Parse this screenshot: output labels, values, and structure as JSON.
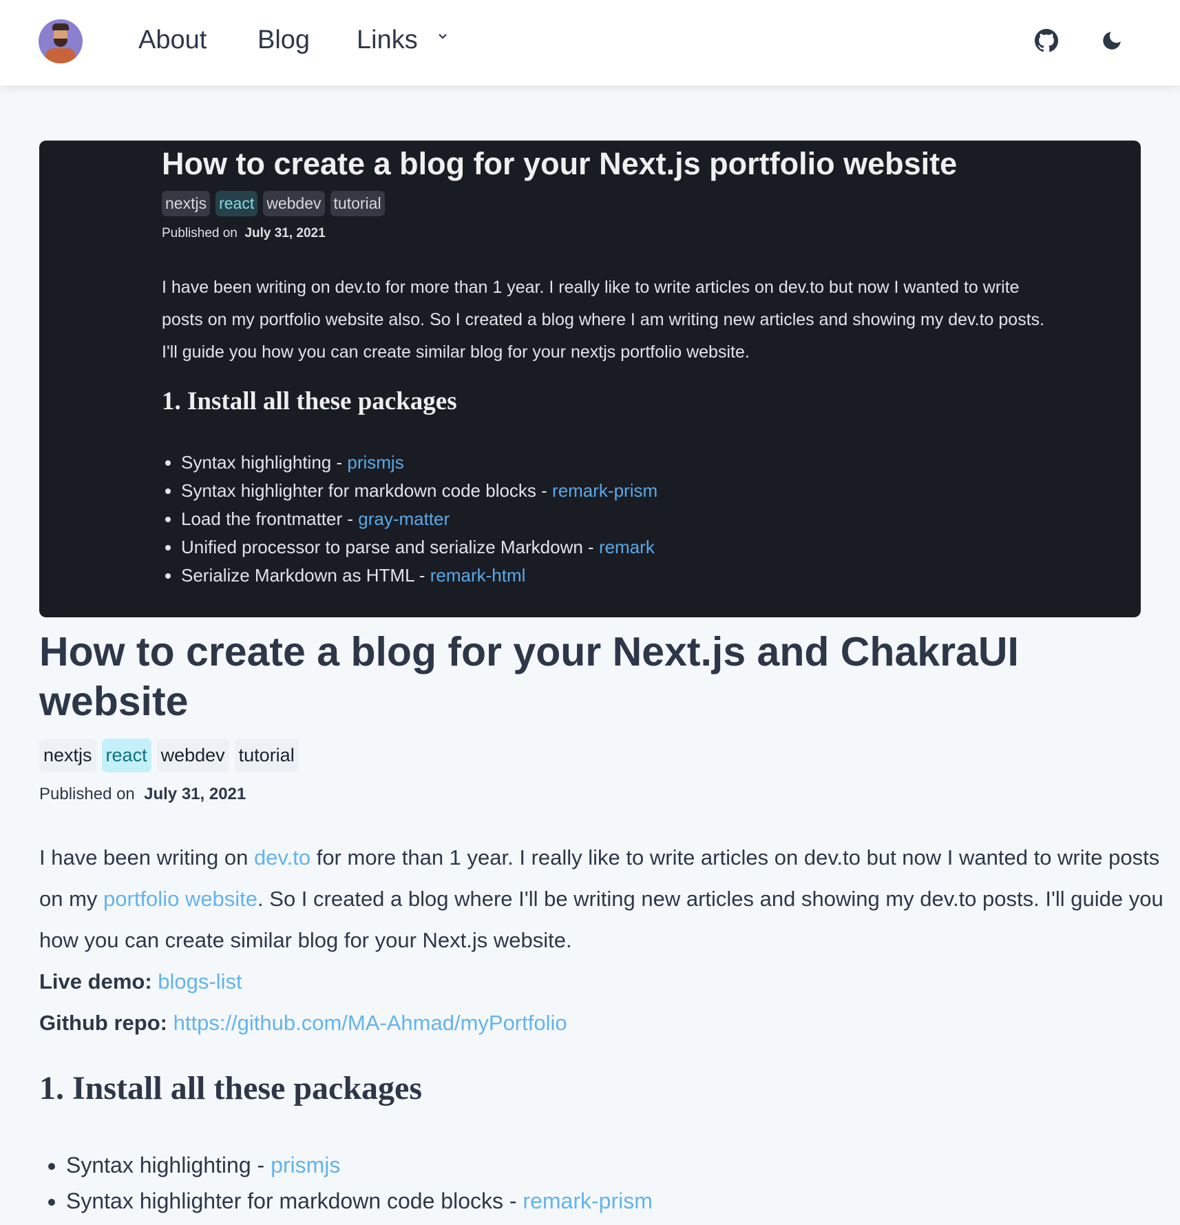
{
  "nav": {
    "links": [
      "About",
      "Blog",
      "Links"
    ],
    "icons": [
      "avatar",
      "github-icon",
      "moon-icon",
      "chevron-down-icon"
    ]
  },
  "hero": {
    "title": "How to create a blog for your Next.js portfolio website",
    "tags": [
      "nextjs",
      "react",
      "webdev",
      "tutorial"
    ],
    "published_label": "Published on",
    "date": "July 31, 2021",
    "paragraph": "I have been writing on dev.to for more than 1 year. I really like to write articles on dev.to but now I wanted to write posts on my portfolio website also. So I created a blog where I am writing new articles and showing my dev.to posts. I'll guide you how you can create similar blog for your nextjs portfolio website.",
    "heading": "1. Install all these packages",
    "items": [
      {
        "text": "Syntax highlighting - ",
        "link": "prismjs"
      },
      {
        "text": "Syntax highlighter for markdown code blocks - ",
        "link": "remark-prism"
      },
      {
        "text": "Load the frontmatter - ",
        "link": "gray-matter"
      },
      {
        "text": "Unified processor to parse and serialize Markdown - ",
        "link": "remark"
      },
      {
        "text": "Serialize Markdown as HTML - ",
        "link": "remark-html"
      }
    ]
  },
  "article": {
    "title": "How to create a blog for your Next.js and ChakraUI website",
    "tags": [
      "nextjs",
      "react",
      "webdev",
      "tutorial"
    ],
    "published_label": "Published on",
    "date": "July 31, 2021",
    "p1": "I have been writing on ",
    "p1_link1": "dev.to",
    "p2": " for more than 1 year. I really like to write articles on dev.to but now I wanted to write posts on my ",
    "p2_link": "portfolio website",
    "p3": ". So I created a blog where I'll be writing new articles and showing my dev.to posts. I'll guide you how you can create similar blog for your Next.js website.",
    "demo_label": "Live demo:",
    "demo_link": "blogs-list",
    "repo_label": "Github repo:",
    "repo_link": "https://github.com/MA-Ahmad/myPortfolio",
    "heading": "1. Install all these packages",
    "items": [
      {
        "text": "Syntax highlighting - ",
        "link": "prismjs"
      },
      {
        "text": "Syntax highlighter for markdown code blocks - ",
        "link": "remark-prism"
      }
    ]
  },
  "colors": {
    "accent": "#63b3ed",
    "text": "#2d3748",
    "hero_bg": "#1a1c24",
    "react_tag": "#c4f1f9"
  }
}
